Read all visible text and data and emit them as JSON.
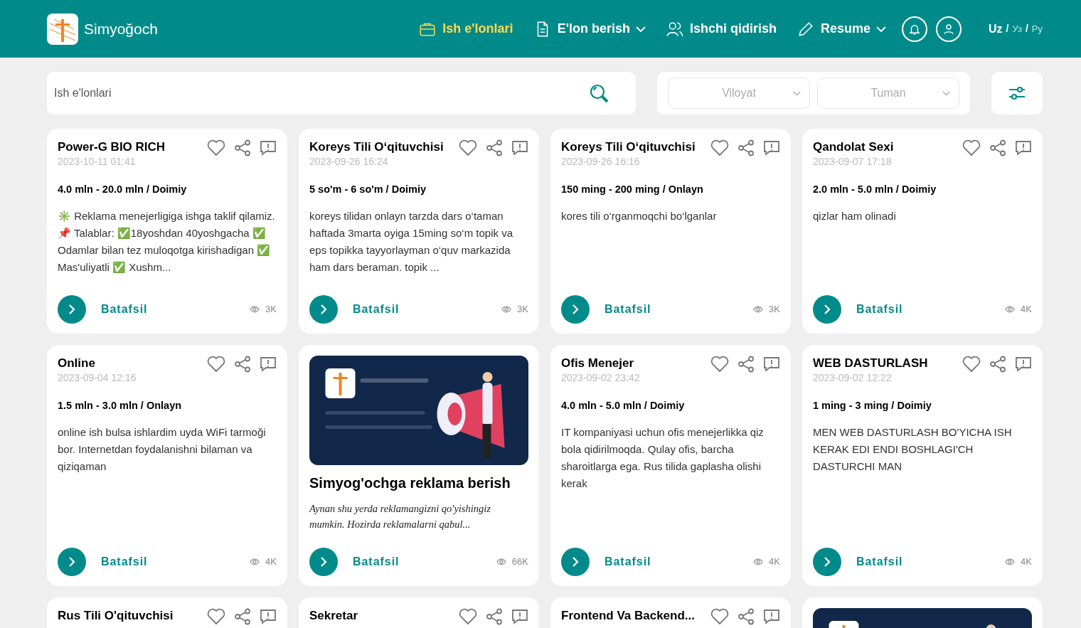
{
  "header": {
    "logo_text": "Simyoğoch",
    "nav": [
      {
        "label": "Ish e'lonlari",
        "dropdown": false,
        "selected": true
      },
      {
        "label": "E'lon berish",
        "dropdown": true,
        "selected": false
      },
      {
        "label": "Ishchi qidirish",
        "dropdown": false,
        "selected": false
      },
      {
        "label": "Resume",
        "dropdown": true,
        "selected": false
      }
    ],
    "languages": [
      {
        "label": "Uz",
        "selected": true
      },
      {
        "label": "Уз",
        "selected": false
      },
      {
        "label": "Ру",
        "selected": false
      }
    ],
    "language_separators": [
      "/",
      "/"
    ]
  },
  "search": {
    "placeholder": "Ish e'lonlari"
  },
  "filters": [
    {
      "placeholder": "Viloyat"
    },
    {
      "placeholder": "Tuman"
    }
  ],
  "cards": [
    {
      "kind": "job",
      "title": "Power-G BIO RICH",
      "date": "2023-10-11 01:41",
      "salary": "4.0 mln - 20.0 mln / Doimiy",
      "description": "✳️ Reklama menejerligiga ishga taklif qilamiz. 📌 Talablar: ✅18yoshdan 40yoshgacha ✅ Odamlar bilan tez muloqotga kirishadigan ✅ Mas'uliyatli ✅ Xushm...",
      "link": "Batafsil",
      "views": "3K"
    },
    {
      "kind": "job",
      "title": "Koreys Tili O‘qituvchisi",
      "date": "2023-09-26 16:24",
      "salary": "5 so'm - 6 so'm / Doimiy",
      "description": "koreys tilidan onlayn tarzda dars o‘taman haftada 3marta oyiga 15ming so‘m topik va eps topikka tayyorlayman o‘quv markazida ham dars beraman. topik ...",
      "link": "Batafsil",
      "views": "3K"
    },
    {
      "kind": "job",
      "title": "Koreys Tili O‘qituvchisi",
      "date": "2023-09-26 16:16",
      "salary": "150 ming - 200 ming / Onlayn",
      "description": "kores tili o‘rganmoqchi bo‘lganlar",
      "link": "Batafsil",
      "views": "3K"
    },
    {
      "kind": "job",
      "title": "Qandolat Sexi",
      "date": "2023-09-07 17:18",
      "salary": "2.0 mln - 5.0 mln / Doimiy",
      "description": "qizlar ham olinadi",
      "link": "Batafsil",
      "views": "4K"
    },
    {
      "kind": "job",
      "title": "Online",
      "date": "2023-09-04 12:16",
      "salary": "1.5 mln - 3.0 mln / Onlayn",
      "description": "online ish bulsa ishlardim uyda WiFi tarmoği bor. Internetdan foydalanishni bilaman va qiziqaman",
      "link": "Batafsil",
      "views": "4K"
    },
    {
      "kind": "ad",
      "title": "Simyog'ochga reklama berish",
      "description": "Aynan shu yerda reklamangizni qo'yishingiz mumkin. Hozirda reklamalarni qabul...",
      "link": "Batafsil",
      "views": "66K"
    },
    {
      "kind": "job",
      "title": "Ofis Menejer",
      "date": "2023-09-02 23:42",
      "salary": "4.0 mln - 5.0 mln / Doimiy",
      "description": "IT kompaniyasi uchun ofis menejerlikka qiz bola qidirilmoqda. Qulay ofis, barcha sharoitlarga ega. Rus tilida gaplasha olishi kerak",
      "link": "Batafsil",
      "views": "4K"
    },
    {
      "kind": "job",
      "title": "WEB DASTURLASH",
      "date": "2023-09-02 12:22",
      "salary": "1 ming - 3 ming / Doimiy",
      "description": "MEN WEB DASTURLASH BO'YICHA ISH KERAK EDI ENDI BOSHLAGI'CH DASTURCHI MAN",
      "link": "Batafsil",
      "views": "4K"
    },
    {
      "kind": "job_partial",
      "title": "Rus Tili O'qituvchisi"
    },
    {
      "kind": "job_partial",
      "title": "Sekretar"
    },
    {
      "kind": "job_partial",
      "title": "Frontend Va Backend..."
    },
    {
      "kind": "ad_partial"
    }
  ]
}
